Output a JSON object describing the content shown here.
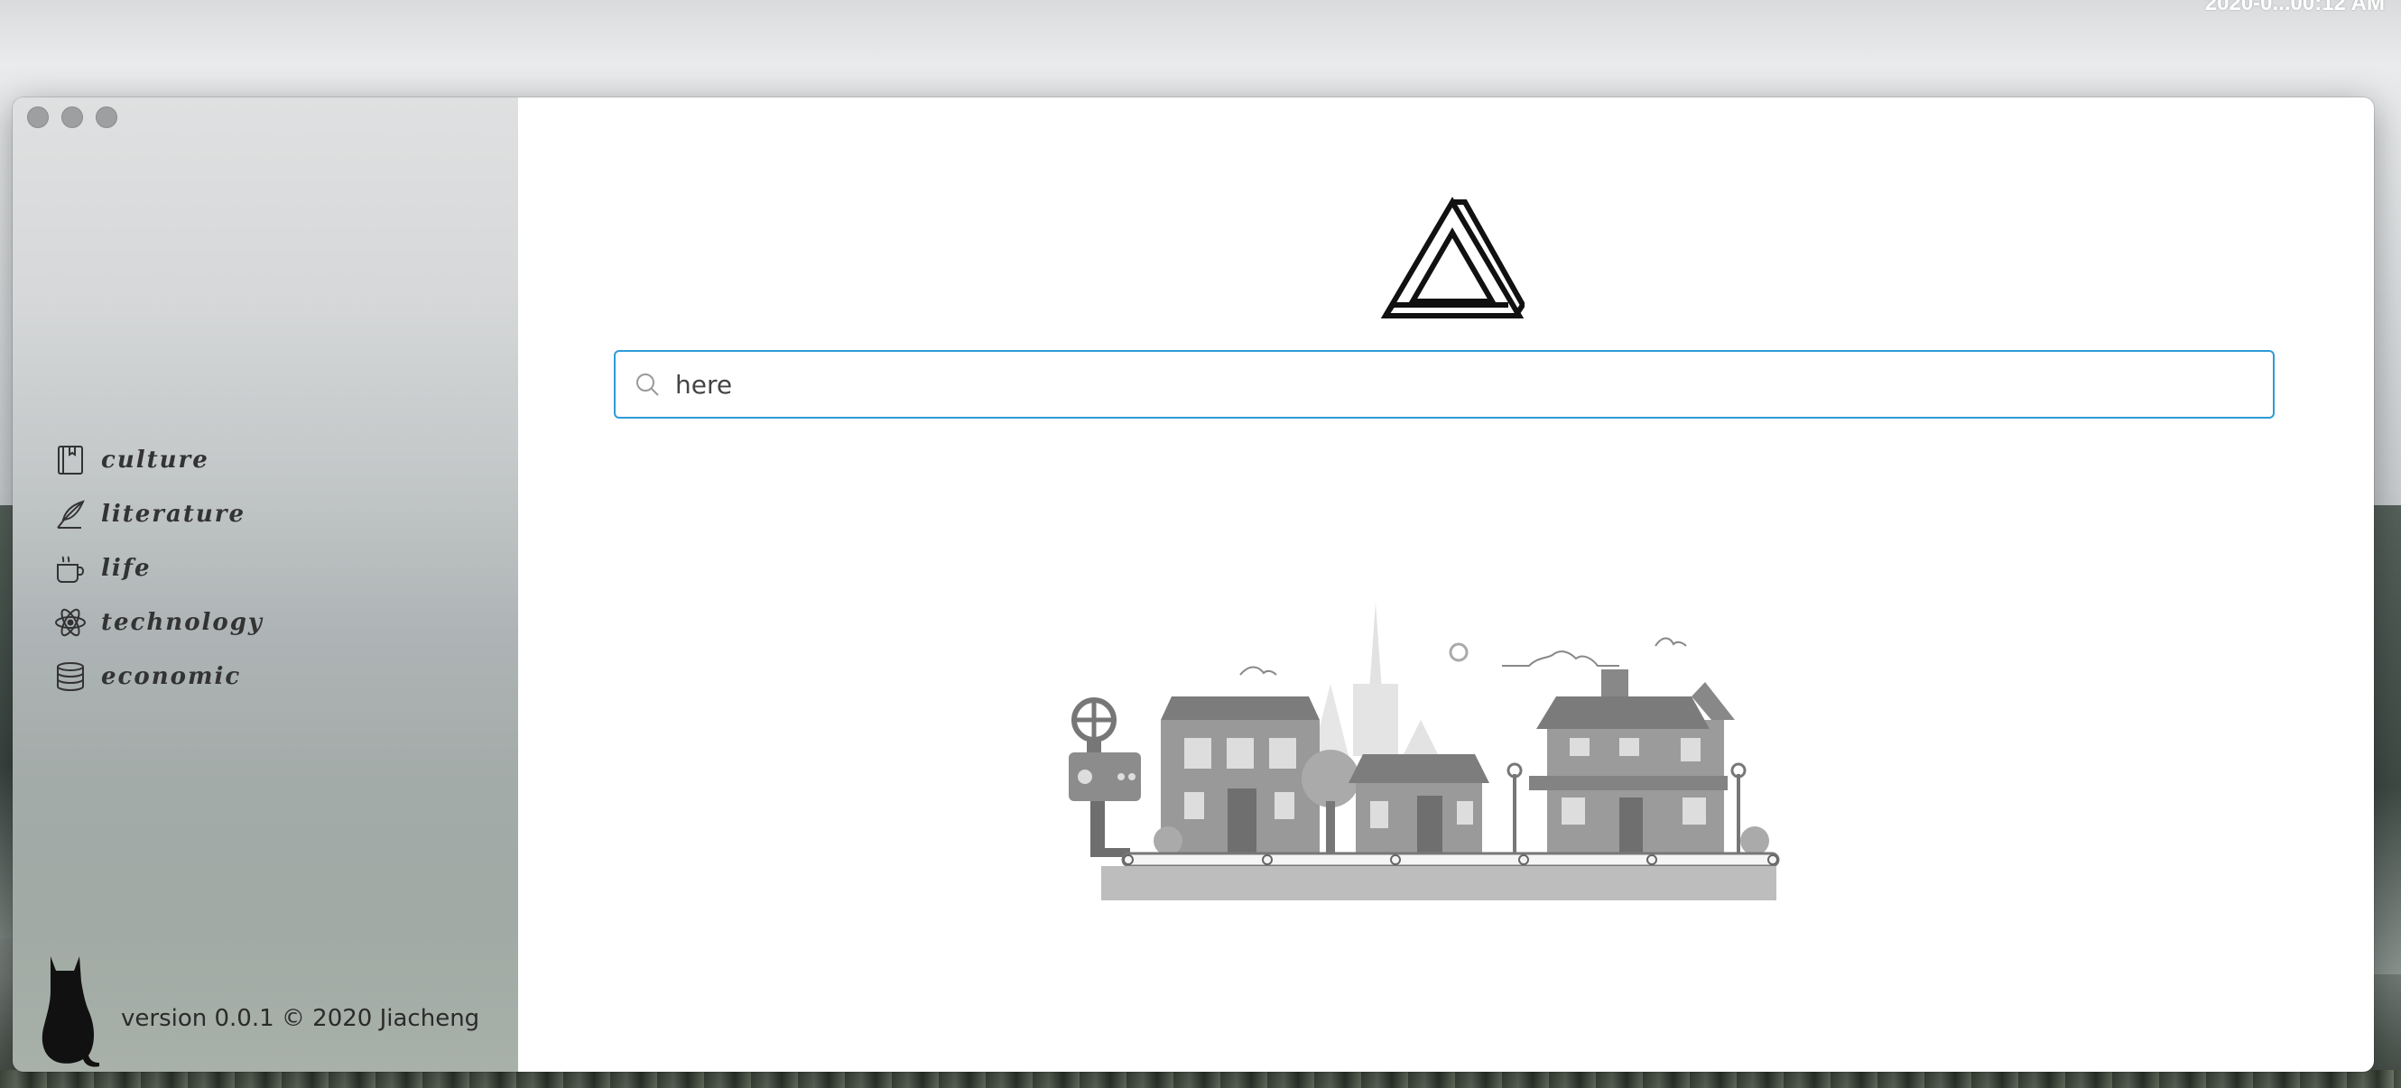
{
  "desktop": {
    "clock": "2020-0...00:12 AM"
  },
  "window": {
    "traffic_lights": [
      "close",
      "minimize",
      "zoom"
    ]
  },
  "sidebar": {
    "items": [
      {
        "label": "culture",
        "icon": "book-icon"
      },
      {
        "label": "literature",
        "icon": "feather-icon"
      },
      {
        "label": "life",
        "icon": "coffee-cup-icon"
      },
      {
        "label": "technology",
        "icon": "atom-icon"
      },
      {
        "label": "economic",
        "icon": "coin-stack-icon"
      }
    ],
    "footer": {
      "version": "version 0.0.1 © 2020 Jiacheng",
      "icon": "cat-icon"
    }
  },
  "main": {
    "logo": "penrose-triangle-logo",
    "search": {
      "value": "here",
      "icon": "search-icon"
    },
    "illustration": "town-illustration"
  },
  "colors": {
    "search_border": "#2d9bd6",
    "text": "#333333",
    "main_bg": "#ffffff"
  }
}
